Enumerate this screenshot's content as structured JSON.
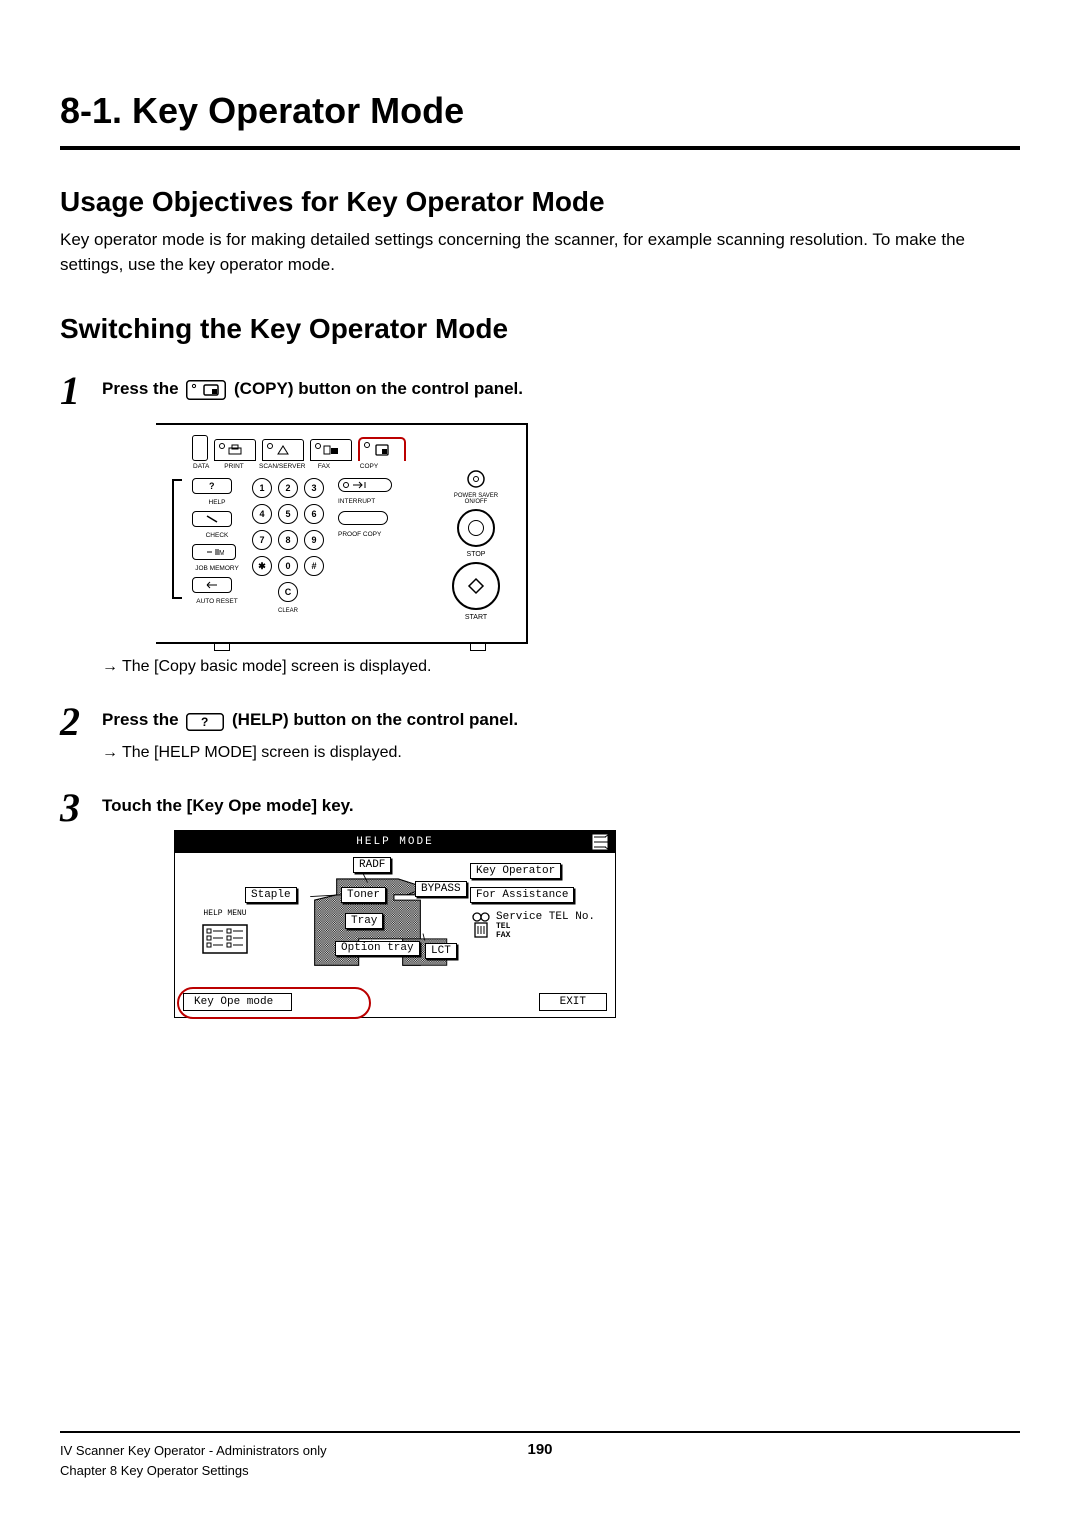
{
  "section_title": "8-1. Key Operator Mode",
  "subhead_usage": "Usage Objectives for Key Operator Mode",
  "usage_body": "Key operator mode is for making detailed settings concerning the scanner, for example scanning resolution. To make the settings, use the key operator mode.",
  "subhead_switch": "Switching the Key Operator Mode",
  "steps": {
    "s1": {
      "num": "1",
      "pre": "Press the ",
      "post": " (COPY) button on the control panel.",
      "result": "The [Copy basic mode] screen is displayed."
    },
    "s2": {
      "num": "2",
      "pre": "Press the ",
      "post": " (HELP) button on the control panel.",
      "result": "The [HELP MODE] screen is displayed."
    },
    "s3": {
      "num": "3",
      "text": "Touch the [Key Ope mode] key."
    }
  },
  "panel": {
    "tabs": {
      "data": "DATA",
      "print": "PRINT",
      "scan": "SCAN/SERVER",
      "fax": "FAX",
      "copy": "COPY"
    },
    "left_labels": {
      "help": "HELP",
      "check": "CHECK",
      "jobmem": "JOB MEMORY",
      "autoreset": "AUTO RESET"
    },
    "right_labels": {
      "interrupt": "INTERRUPT",
      "proof": "PROOF COPY",
      "power": "POWER SAVER\nON/OFF",
      "stop": "STOP",
      "start": "START"
    },
    "keypad": [
      "1",
      "2",
      "3",
      "4",
      "5",
      "6",
      "7",
      "8",
      "9",
      "✱",
      "0",
      "#"
    ],
    "clear_key": "C",
    "clear_label": "CLEAR"
  },
  "help_screen": {
    "title": "HELP MODE",
    "left_menu_label": "HELP MENU",
    "center_buttons": {
      "staple": "Staple",
      "radf": "RADF",
      "toner": "Toner",
      "bypass": "BYPASS",
      "tray": "Tray",
      "option": "Option tray",
      "lct": "LCT"
    },
    "right": {
      "keyop": "Key Operator",
      "assist": "For Assistance",
      "svc": "Service TEL No.",
      "tel": "TEL",
      "fax": "FAX"
    },
    "bottom": {
      "kom": "Key Ope mode",
      "exit": "EXIT"
    }
  },
  "footer": {
    "line1": "IV Scanner Key Operator - Administrators only",
    "line2": "Chapter 8 Key Operator Settings",
    "page": "190"
  }
}
